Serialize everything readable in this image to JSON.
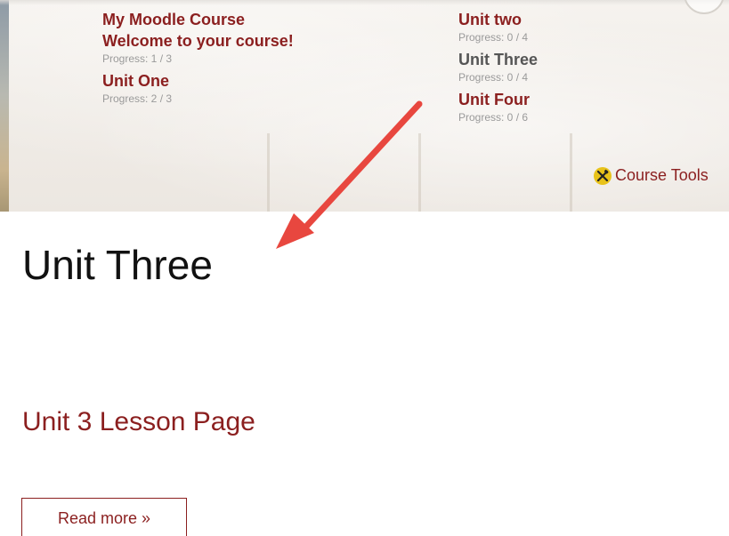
{
  "nav": {
    "left": [
      {
        "label": "My Moodle Course"
      },
      {
        "label": "Welcome to your course!",
        "progress": "Progress: 1 / 3"
      },
      {
        "label": "Unit One",
        "progress": "Progress: 2 / 3"
      }
    ],
    "right": [
      {
        "label": "Unit two",
        "progress": "Progress: 0 / 4"
      },
      {
        "label": "Unit Three",
        "progress": "Progress: 0 / 4"
      },
      {
        "label": "Unit Four",
        "progress": "Progress: 0 / 6"
      }
    ]
  },
  "course_tools": {
    "label": "Course Tools",
    "icon": "tools-icon"
  },
  "main": {
    "title": "Unit Three",
    "lesson_link": "Unit 3 Lesson Page",
    "read_more": "Read more »"
  },
  "colors": {
    "link": "#8b1f1f",
    "current": "#555555",
    "progress": "#9a9a9a",
    "arrow": "#e8473f",
    "tools_icon_bg": "#e8c21a"
  }
}
